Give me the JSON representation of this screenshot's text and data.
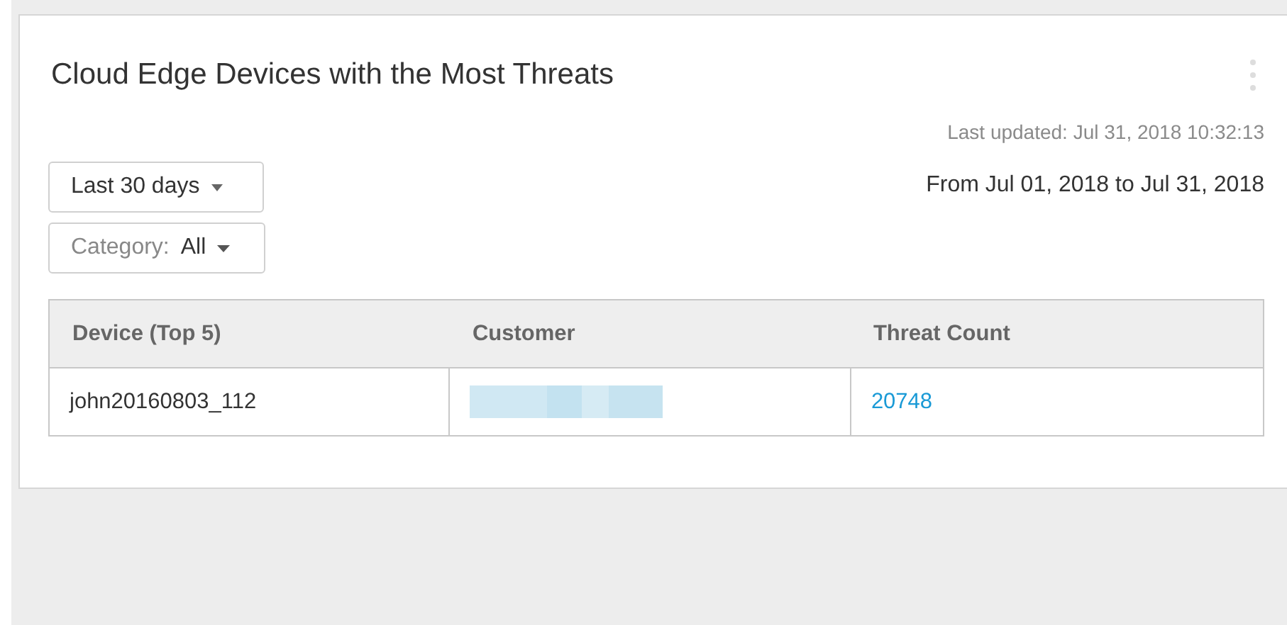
{
  "widget": {
    "title": "Cloud Edge Devices with the Most Threats",
    "last_updated": "Last updated: Jul 31, 2018 10:32:13",
    "date_range": "From Jul 01, 2018 to Jul 31, 2018",
    "period_dropdown": {
      "value": "Last 30 days"
    },
    "category_dropdown": {
      "label": "Category:",
      "value": "All"
    },
    "table": {
      "columns": [
        "Device (Top 5)",
        "Customer",
        "Threat Count"
      ],
      "rows": [
        {
          "device": "john20160803_112",
          "customer": {
            "kind": "redacted"
          },
          "threat_count": "20748"
        }
      ]
    }
  }
}
